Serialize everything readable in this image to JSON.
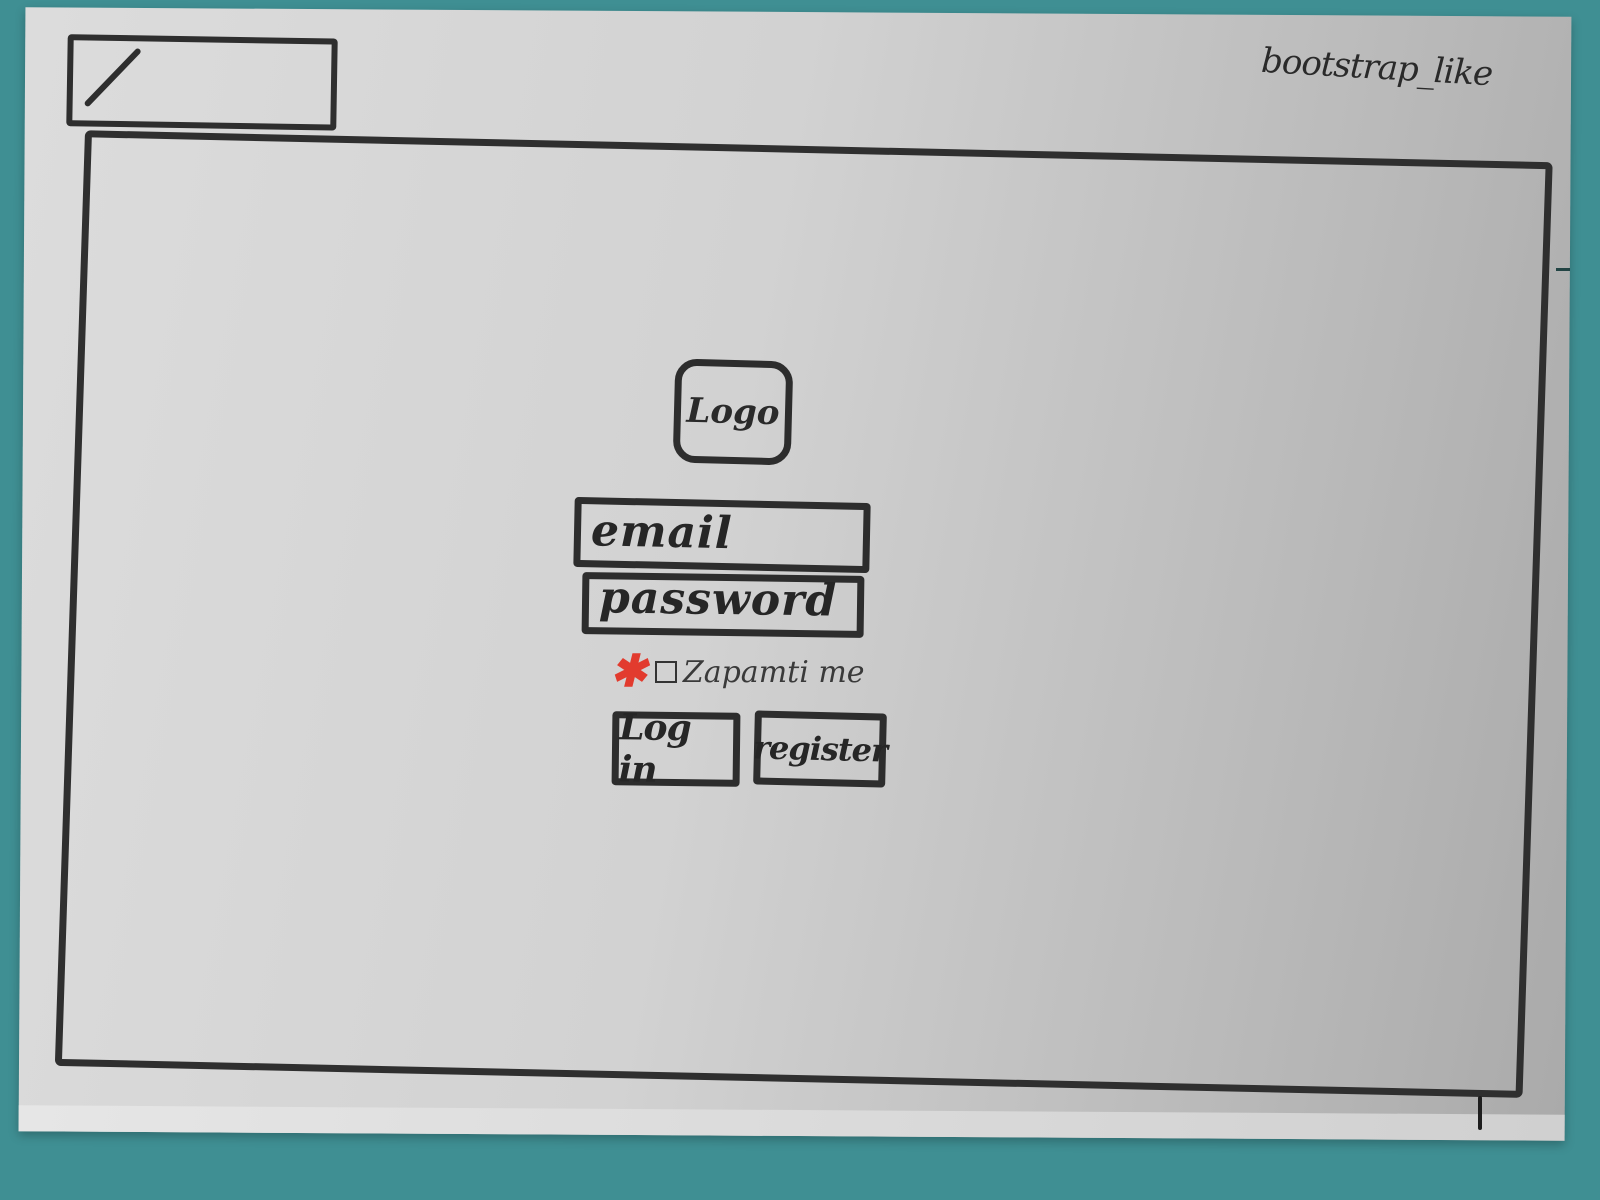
{
  "header": {
    "brand": "bootstrap_like"
  },
  "login": {
    "logo_label": "Logo",
    "email_placeholder": "email",
    "password_placeholder": "password",
    "remember_label": "Zapamti me",
    "required_mark": "✱",
    "login_button": "Log in",
    "register_button": "register"
  },
  "colors": {
    "required_mark": "#e23b2e",
    "sketch_ink": "#2d2d2d",
    "background": "#3f8f93"
  }
}
